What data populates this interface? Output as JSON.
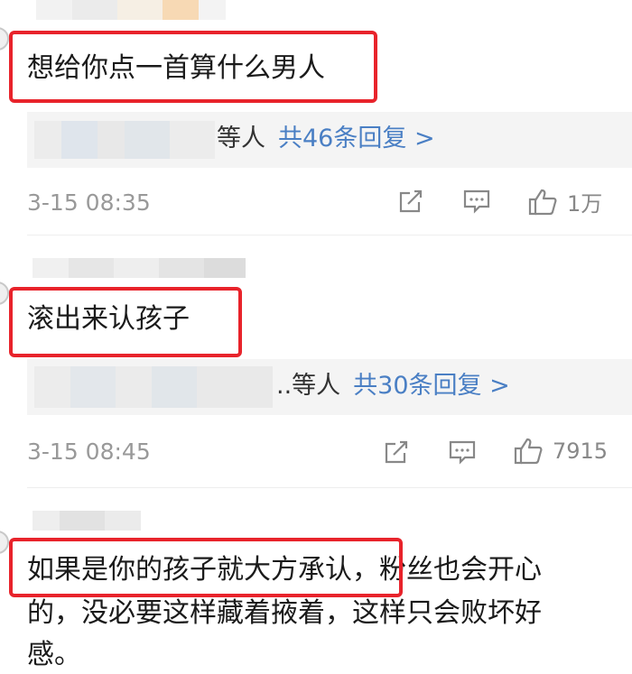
{
  "comments": [
    {
      "text": "想给你点一首算什么男人",
      "reply_who": "等人",
      "reply_count": "共46条回复 >",
      "time": "3-15 08:35",
      "likes": "1万"
    },
    {
      "text": "滚出来认孩子",
      "reply_who": "..等人",
      "reply_count": "共30条回复 >",
      "time": "3-15 08:45",
      "likes": "7915"
    },
    {
      "text_line1": "如果是你的孩子就大方承认，粉丝也会开心",
      "text_line2": "的，没必要这样藏着掖着，这样只会败坏好",
      "text_line3": "感。"
    }
  ],
  "icons": {
    "share": "share-icon",
    "comment": "comment-icon",
    "like": "thumbs-up-icon"
  },
  "colors": {
    "highlight": "#e8232b",
    "link": "#4a7fc4",
    "meta": "#999999",
    "reply_bg": "#f4f4f4"
  }
}
